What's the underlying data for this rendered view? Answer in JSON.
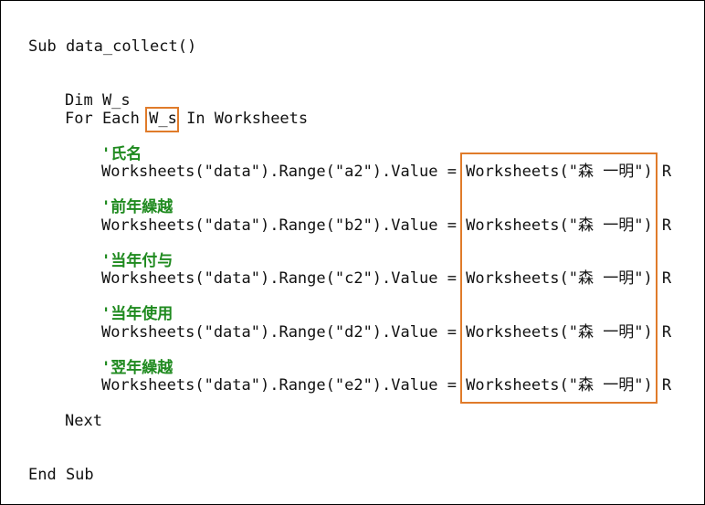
{
  "code": {
    "sub_open": "Sub data_collect()",
    "dim": "Dim W_s",
    "for_prefix": "For Each ",
    "loop_var": "W_s",
    "for_suffix": " In Worksheets",
    "blocks": [
      {
        "comment": "'氏名",
        "code_left": "Worksheets(\"data\").Range(\"a2\").Value = ",
        "code_right": "Worksheets(\"森 一明\") R"
      },
      {
        "comment": "'前年繰越",
        "code_left": "Worksheets(\"data\").Range(\"b2\").Value = ",
        "code_right": "Worksheets(\"森 一明\") R"
      },
      {
        "comment": "'当年付与",
        "code_left": "Worksheets(\"data\").Range(\"c2\").Value = ",
        "code_right": "Worksheets(\"森 一明\") R"
      },
      {
        "comment": "'当年使用",
        "code_left": "Worksheets(\"data\").Range(\"d2\").Value = ",
        "code_right": "Worksheets(\"森 一明\") R"
      },
      {
        "comment": "'翌年繰越",
        "code_left": "Worksheets(\"data\").Range(\"e2\").Value = ",
        "code_right": "Worksheets(\"森 一明\") R"
      }
    ],
    "next": "Next",
    "sub_close": "End Sub"
  },
  "colors": {
    "comment": "#1f8a1f",
    "highlight_box": "#e07b2a",
    "text": "#111111"
  }
}
